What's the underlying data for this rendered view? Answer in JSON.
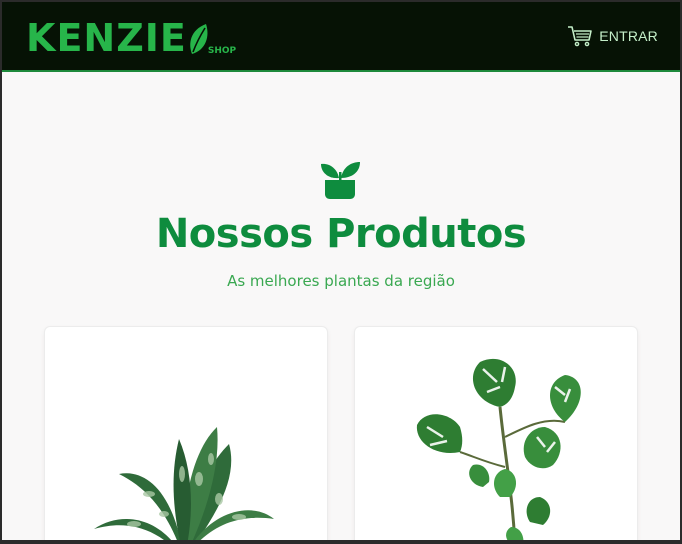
{
  "header": {
    "logo": {
      "wordmark": "KENZIE",
      "suffix": "SHOP"
    },
    "login": {
      "icon": "cart-icon",
      "label": "ENTRAR"
    }
  },
  "hero": {
    "icon": "plant-pot-icon",
    "title": "Nossos Produtos",
    "subtitle": "As melhores plantas da região"
  },
  "products": [
    {
      "image": "aglaonema-plant-image"
    },
    {
      "image": "monstera-plant-image"
    }
  ],
  "colors": {
    "header_bg": "#061205",
    "brand_green": "#27b54a",
    "title_green": "#0e8c3e",
    "subtitle_green": "#3aa851",
    "page_bg": "#f9f8f8"
  }
}
